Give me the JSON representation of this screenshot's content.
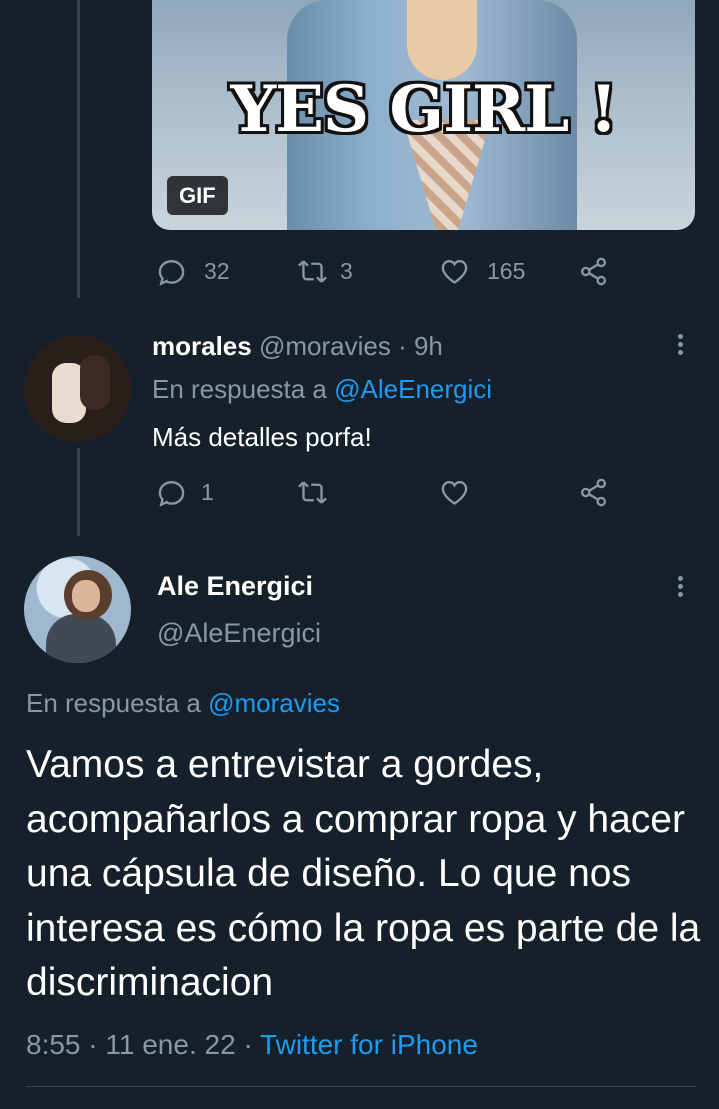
{
  "gif": {
    "caption_text": "YES GIRL !",
    "badge": "GIF"
  },
  "tweet1_actions": {
    "replies": "32",
    "retweets": "3",
    "likes": "165"
  },
  "reply_tweet": {
    "display_name": "morales",
    "handle": "@moravies",
    "time": "· 9h",
    "reply_prefix": "En respuesta a",
    "reply_to": "@AleEnergici",
    "text": "Más detalles porfa!",
    "actions": {
      "replies": "1",
      "retweets": "",
      "likes": ""
    }
  },
  "main_tweet": {
    "display_name": "Ale Energici",
    "handle": "@AleEnergici",
    "reply_prefix": "En respuesta a",
    "reply_to": "@moravies",
    "text": "Vamos a entrevistar a gordes, acompañarlos a comprar ropa y hacer una cápsula de diseño. Lo que nos interesa es cómo la ropa es parte de la discriminacion",
    "time": "8:55",
    "date": "11 ene. 22",
    "separator": "·",
    "source": "Twitter for iPhone"
  },
  "colors": {
    "background": "#15202b",
    "accent": "#1d9bf0",
    "muted": "#8899a6",
    "line": "#38444d"
  },
  "icons": [
    "reply-icon",
    "retweet-icon",
    "like-icon",
    "share-icon",
    "more-icon"
  ]
}
